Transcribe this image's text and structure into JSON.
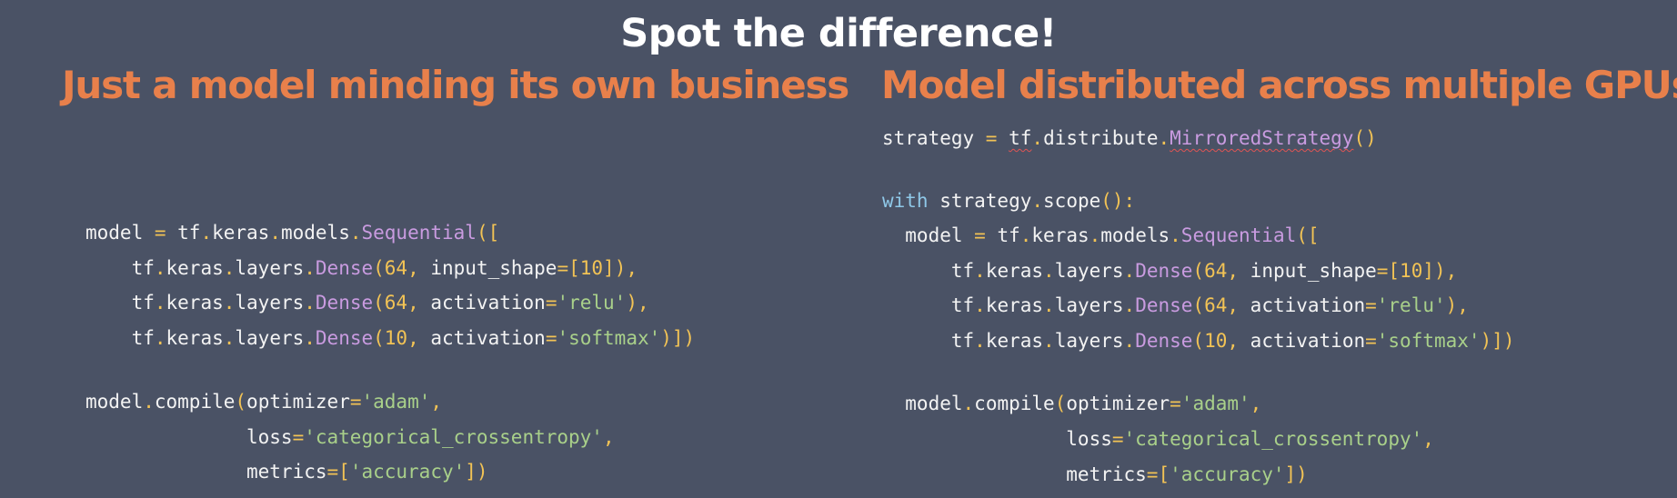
{
  "title": "Spot the difference!",
  "left": {
    "heading": "Just a model minding its own business",
    "code": [
      [
        {
          "t": "model ",
          "c": ""
        },
        {
          "t": "=",
          "c": "op"
        },
        {
          "t": " tf",
          "c": ""
        },
        {
          "t": ".",
          "c": "op"
        },
        {
          "t": "keras",
          "c": ""
        },
        {
          "t": ".",
          "c": "op"
        },
        {
          "t": "models",
          "c": ""
        },
        {
          "t": ".",
          "c": "op"
        },
        {
          "t": "Sequential",
          "c": "fn"
        },
        {
          "t": "([",
          "c": "op"
        }
      ],
      [
        {
          "t": "    tf",
          "c": ""
        },
        {
          "t": ".",
          "c": "op"
        },
        {
          "t": "keras",
          "c": ""
        },
        {
          "t": ".",
          "c": "op"
        },
        {
          "t": "layers",
          "c": ""
        },
        {
          "t": ".",
          "c": "op"
        },
        {
          "t": "Dense",
          "c": "fn"
        },
        {
          "t": "(",
          "c": "op"
        },
        {
          "t": "64",
          "c": "num"
        },
        {
          "t": ",",
          "c": "op"
        },
        {
          "t": " input_shape",
          "c": ""
        },
        {
          "t": "=[",
          "c": "op"
        },
        {
          "t": "10",
          "c": "num"
        },
        {
          "t": "]),",
          "c": "op"
        }
      ],
      [
        {
          "t": "    tf",
          "c": ""
        },
        {
          "t": ".",
          "c": "op"
        },
        {
          "t": "keras",
          "c": ""
        },
        {
          "t": ".",
          "c": "op"
        },
        {
          "t": "layers",
          "c": ""
        },
        {
          "t": ".",
          "c": "op"
        },
        {
          "t": "Dense",
          "c": "fn"
        },
        {
          "t": "(",
          "c": "op"
        },
        {
          "t": "64",
          "c": "num"
        },
        {
          "t": ",",
          "c": "op"
        },
        {
          "t": " activation",
          "c": ""
        },
        {
          "t": "=",
          "c": "op"
        },
        {
          "t": "'relu'",
          "c": "str"
        },
        {
          "t": "),",
          "c": "op"
        }
      ],
      [
        {
          "t": "    tf",
          "c": ""
        },
        {
          "t": ".",
          "c": "op"
        },
        {
          "t": "keras",
          "c": ""
        },
        {
          "t": ".",
          "c": "op"
        },
        {
          "t": "layers",
          "c": ""
        },
        {
          "t": ".",
          "c": "op"
        },
        {
          "t": "Dense",
          "c": "fn"
        },
        {
          "t": "(",
          "c": "op"
        },
        {
          "t": "10",
          "c": "num"
        },
        {
          "t": ",",
          "c": "op"
        },
        {
          "t": " activation",
          "c": ""
        },
        {
          "t": "=",
          "c": "op"
        },
        {
          "t": "'softmax'",
          "c": "str"
        },
        {
          "t": ")])",
          "c": "op"
        }
      ],
      [
        {
          "t": "model",
          "c": ""
        },
        {
          "t": ".",
          "c": "op"
        },
        {
          "t": "compile",
          "c": ""
        },
        {
          "t": "(",
          "c": "op"
        },
        {
          "t": "optimizer",
          "c": ""
        },
        {
          "t": "=",
          "c": "op"
        },
        {
          "t": "'adam'",
          "c": "str"
        },
        {
          "t": ",",
          "c": "op"
        }
      ],
      [
        {
          "t": "              loss",
          "c": ""
        },
        {
          "t": "=",
          "c": "op"
        },
        {
          "t": "'categorical_crossentropy'",
          "c": "str"
        },
        {
          "t": ",",
          "c": "op"
        }
      ],
      [
        {
          "t": "              metrics",
          "c": ""
        },
        {
          "t": "=[",
          "c": "op"
        },
        {
          "t": "'accuracy'",
          "c": "str"
        },
        {
          "t": "])",
          "c": "op"
        }
      ]
    ]
  },
  "right": {
    "heading": "Model distributed across multiple GPUs",
    "code": [
      [
        {
          "t": "strategy ",
          "c": ""
        },
        {
          "t": "=",
          "c": "op"
        },
        {
          "t": " ",
          "c": ""
        },
        {
          "t": "tf",
          "c": "sq"
        },
        {
          "t": ".",
          "c": "op"
        },
        {
          "t": "distribute",
          "c": ""
        },
        {
          "t": ".",
          "c": "op"
        },
        {
          "t": "MirroredStrategy",
          "c": "fn sq"
        },
        {
          "t": "()",
          "c": "op"
        }
      ],
      [
        {
          "t": "with",
          "c": "kw"
        },
        {
          "t": " strategy",
          "c": ""
        },
        {
          "t": ".",
          "c": "op"
        },
        {
          "t": "scope",
          "c": ""
        },
        {
          "t": "():",
          "c": "op"
        }
      ],
      [
        {
          "t": "  model ",
          "c": ""
        },
        {
          "t": "=",
          "c": "op"
        },
        {
          "t": " tf",
          "c": ""
        },
        {
          "t": ".",
          "c": "op"
        },
        {
          "t": "keras",
          "c": ""
        },
        {
          "t": ".",
          "c": "op"
        },
        {
          "t": "models",
          "c": ""
        },
        {
          "t": ".",
          "c": "op"
        },
        {
          "t": "Sequential",
          "c": "fn"
        },
        {
          "t": "([",
          "c": "op"
        }
      ],
      [
        {
          "t": "      tf",
          "c": ""
        },
        {
          "t": ".",
          "c": "op"
        },
        {
          "t": "keras",
          "c": ""
        },
        {
          "t": ".",
          "c": "op"
        },
        {
          "t": "layers",
          "c": ""
        },
        {
          "t": ".",
          "c": "op"
        },
        {
          "t": "Dense",
          "c": "fn"
        },
        {
          "t": "(",
          "c": "op"
        },
        {
          "t": "64",
          "c": "num"
        },
        {
          "t": ",",
          "c": "op"
        },
        {
          "t": " input_shape",
          "c": ""
        },
        {
          "t": "=[",
          "c": "op"
        },
        {
          "t": "10",
          "c": "num"
        },
        {
          "t": "]),",
          "c": "op"
        }
      ],
      [
        {
          "t": "      tf",
          "c": ""
        },
        {
          "t": ".",
          "c": "op"
        },
        {
          "t": "keras",
          "c": ""
        },
        {
          "t": ".",
          "c": "op"
        },
        {
          "t": "layers",
          "c": ""
        },
        {
          "t": ".",
          "c": "op"
        },
        {
          "t": "Dense",
          "c": "fn"
        },
        {
          "t": "(",
          "c": "op"
        },
        {
          "t": "64",
          "c": "num"
        },
        {
          "t": ",",
          "c": "op"
        },
        {
          "t": " activation",
          "c": ""
        },
        {
          "t": "=",
          "c": "op"
        },
        {
          "t": "'relu'",
          "c": "str"
        },
        {
          "t": "),",
          "c": "op"
        }
      ],
      [
        {
          "t": "      tf",
          "c": ""
        },
        {
          "t": ".",
          "c": "op"
        },
        {
          "t": "keras",
          "c": ""
        },
        {
          "t": ".",
          "c": "op"
        },
        {
          "t": "layers",
          "c": ""
        },
        {
          "t": ".",
          "c": "op"
        },
        {
          "t": "Dense",
          "c": "fn"
        },
        {
          "t": "(",
          "c": "op"
        },
        {
          "t": "10",
          "c": "num"
        },
        {
          "t": ",",
          "c": "op"
        },
        {
          "t": " activation",
          "c": ""
        },
        {
          "t": "=",
          "c": "op"
        },
        {
          "t": "'softmax'",
          "c": "str"
        },
        {
          "t": ")])",
          "c": "op"
        }
      ],
      [
        {
          "t": "  model",
          "c": ""
        },
        {
          "t": ".",
          "c": "op"
        },
        {
          "t": "compile",
          "c": ""
        },
        {
          "t": "(",
          "c": "op"
        },
        {
          "t": "optimizer",
          "c": ""
        },
        {
          "t": "=",
          "c": "op"
        },
        {
          "t": "'adam'",
          "c": "str"
        },
        {
          "t": ",",
          "c": "op"
        }
      ],
      [
        {
          "t": "                loss",
          "c": ""
        },
        {
          "t": "=",
          "c": "op"
        },
        {
          "t": "'categorical_crossentropy'",
          "c": "str"
        },
        {
          "t": ",",
          "c": "op"
        }
      ],
      [
        {
          "t": "                metrics",
          "c": ""
        },
        {
          "t": "=[",
          "c": "op"
        },
        {
          "t": "'accuracy'",
          "c": "str"
        },
        {
          "t": "])",
          "c": "op"
        }
      ]
    ]
  }
}
